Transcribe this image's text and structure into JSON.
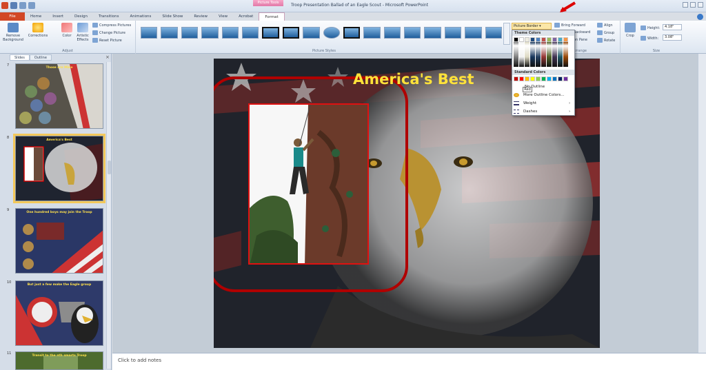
{
  "window": {
    "title": "Troop Presentation Ballad of an Eagle Scout - Microsoft PowerPoint",
    "context_tab": "Picture Tools"
  },
  "tabs": [
    "File",
    "Home",
    "Insert",
    "Design",
    "Transitions",
    "Animations",
    "Slide Show",
    "Review",
    "View",
    "Acrobat",
    "Format"
  ],
  "ribbon": {
    "adjust": {
      "remove_background": "Remove Background",
      "corrections": "Corrections",
      "color": "Color",
      "artistic_effects": "Artistic Effects",
      "compress": "Compress Pictures",
      "change": "Change Picture",
      "reset": "Reset Picture",
      "label": "Adjust"
    },
    "styles_label": "Picture Styles",
    "picture_border": "Picture Border",
    "arrange": {
      "bring_forward": "Bring Forward",
      "send_backward": "Backward",
      "selection_pane": "on Pane",
      "align": "Align",
      "group": "Group",
      "rotate": "Rotate",
      "label": "Arrange"
    },
    "size": {
      "crop": "Crop",
      "height_label": "Height:",
      "height_value": "4.18\"",
      "width_label": "Width:",
      "width_value": "3.08\"",
      "label": "Size"
    }
  },
  "dropdown": {
    "theme_colors": "Theme Colors",
    "standard_colors": "Standard Colors",
    "no_outline": "No Outline",
    "more_colors": "More Outline Colors...",
    "weight": "Weight",
    "dashes": "Dashes",
    "tooltip": "Red",
    "theme_top": [
      "#000000",
      "#ffffff",
      "#eeece1",
      "#1f497d",
      "#4f81bd",
      "#c0504d",
      "#9bbb59",
      "#8064a2",
      "#4bacc6",
      "#f79646"
    ],
    "grad_cols": [
      "#7f7f7f",
      "#f2f2f2",
      "#ddd9c3",
      "#17365d",
      "#254061",
      "#953735",
      "#4f6228",
      "#3f3151",
      "#215968",
      "#984807"
    ],
    "standard": [
      "#c00000",
      "#ff0000",
      "#ffc000",
      "#ffff00",
      "#92d050",
      "#00b050",
      "#00b0f0",
      "#0070c0",
      "#002060",
      "#7030a0"
    ]
  },
  "left_panel": {
    "tabs": [
      "Slides",
      "Outline"
    ],
    "close": "×",
    "slides": [
      {
        "num": "7",
        "title": "Those are Mine"
      },
      {
        "num": "8",
        "title": "America's Best"
      },
      {
        "num": "9",
        "title": "One hundred boys may join the Troop"
      },
      {
        "num": "10",
        "title": "But just a few make the Eagle group"
      },
      {
        "num": "11",
        "title": "Transit to the nth smarts Troop"
      }
    ]
  },
  "slide": {
    "title": "America's Best"
  },
  "notes": {
    "placeholder": "Click to add notes"
  }
}
